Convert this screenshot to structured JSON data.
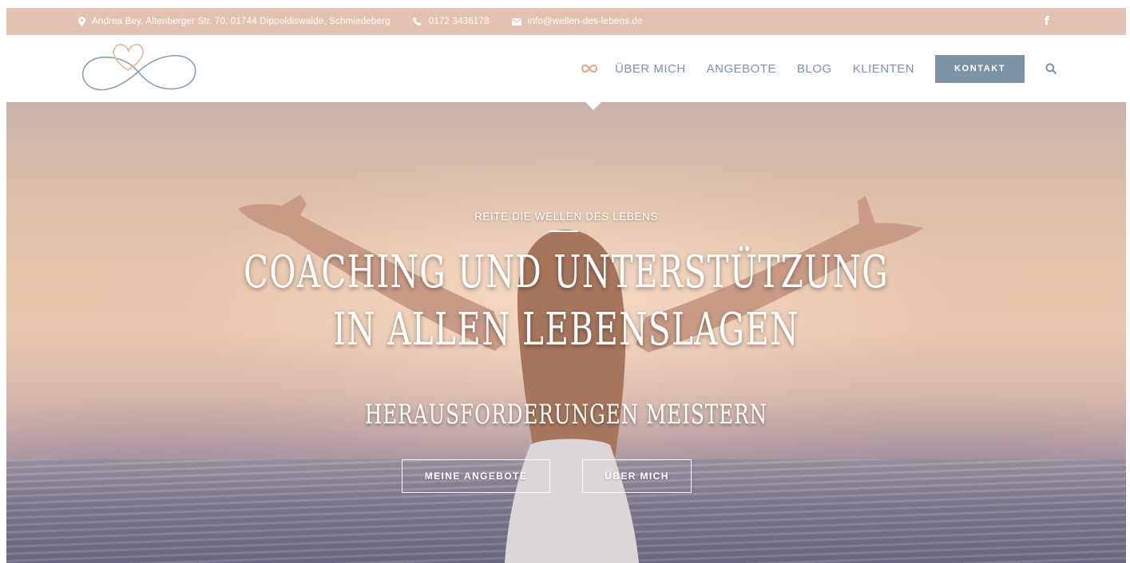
{
  "topbar": {
    "address": "Andrea Bey, Altenberger Str. 70, 01744 Dippoldiswalde, Schmiedeberg",
    "phone": "0172 3436178",
    "email": "info@wellen-des-lebens.de",
    "social": "f"
  },
  "nav": {
    "items": [
      {
        "label": "ÜBER MICH"
      },
      {
        "label": "ANGEBOTE"
      },
      {
        "label": "BLOG"
      },
      {
        "label": "KLIENTEN"
      }
    ],
    "cta": "KONTAKT"
  },
  "hero": {
    "tagline": "REITE DIE WELLEN DES LEBENS",
    "headline_line1": "Coaching und Unterstützung",
    "headline_line2": "in allen Lebenslagen",
    "subheadline": "Herausforderungen meistern",
    "buttons": [
      {
        "label": "MEINE ANGEBOTE"
      },
      {
        "label": "ÜBER MICH"
      }
    ]
  },
  "colors": {
    "topbar": "#e1c2b3",
    "nav_text": "#7d94a4",
    "cta_bg": "#7d93a3",
    "accent": "#e6a98b"
  }
}
